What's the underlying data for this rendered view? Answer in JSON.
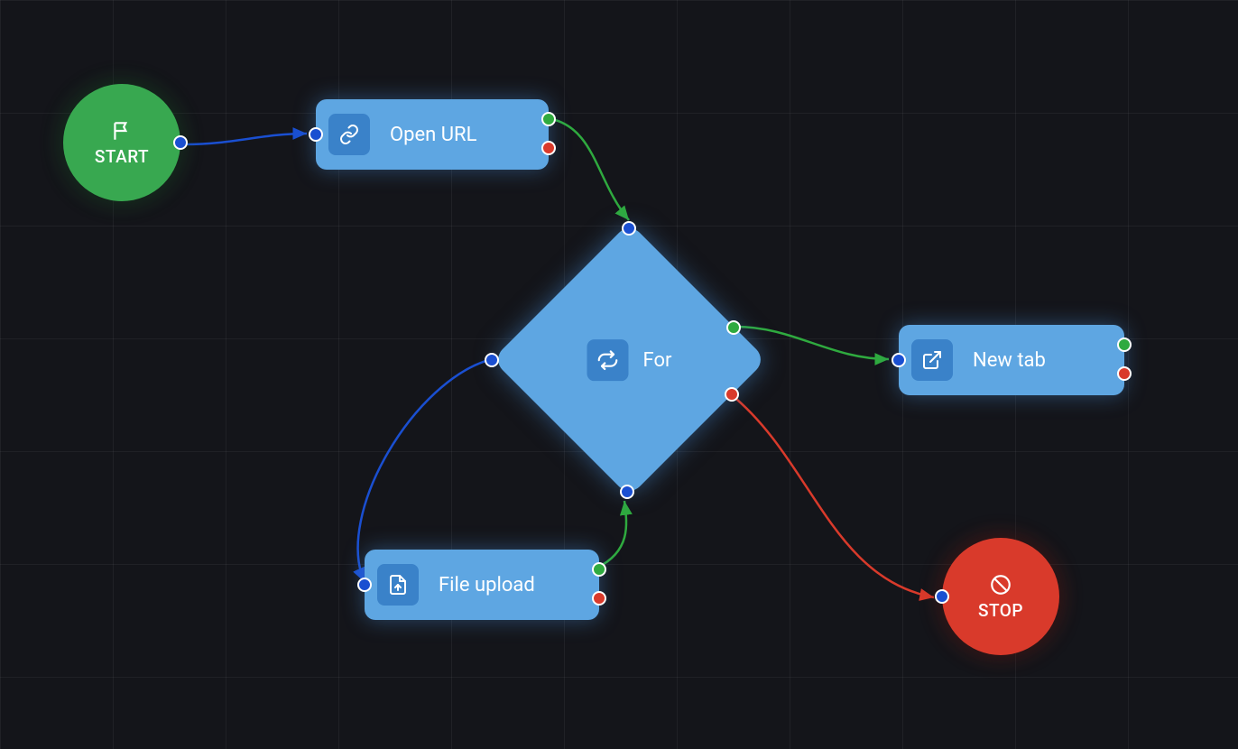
{
  "nodes": {
    "start": {
      "label": "START"
    },
    "open_url": {
      "label": "Open URL"
    },
    "for": {
      "label": "For"
    },
    "new_tab": {
      "label": "New tab"
    },
    "file_upload": {
      "label": "File upload"
    },
    "stop": {
      "label": "STOP"
    }
  },
  "colors": {
    "node_blue": "#5ea6e2",
    "start_green": "#38a850",
    "stop_red": "#d93a2b",
    "edge_blue": "#1a4fd1",
    "edge_green": "#2faa3f",
    "edge_red": "#d93a2b"
  }
}
